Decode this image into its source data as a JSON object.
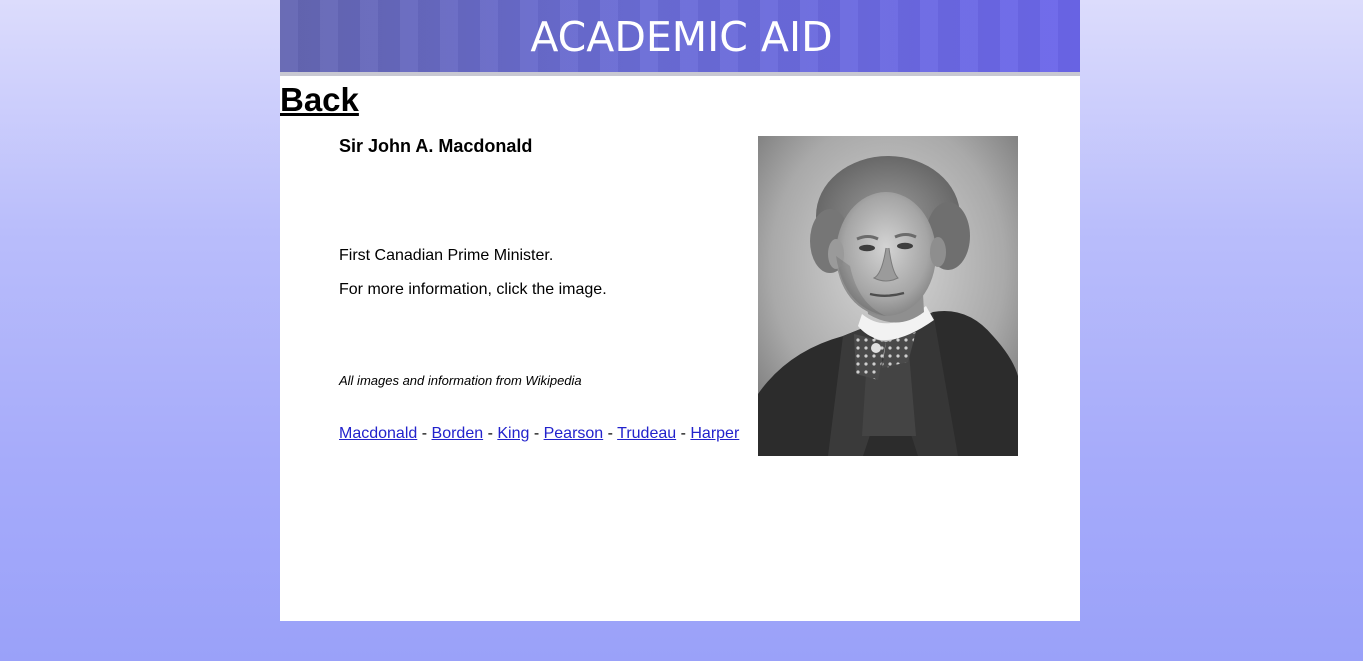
{
  "banner": {
    "title": "ACADEMIC AID"
  },
  "nav": {
    "back_label": "Back"
  },
  "main": {
    "name": "Sir John A. Macdonald",
    "description_line1": "First Canadian Prime Minister.",
    "description_line2": "For more information, click the image.",
    "credit": "All images and information from Wikipedia",
    "separator": "-",
    "pm_links": [
      "Macdonald",
      "Borden",
      "King",
      "Pearson",
      "Trudeau",
      "Harper"
    ]
  },
  "colors": {
    "link": "#2222cc",
    "banner_start": "#6466b2",
    "banner_end": "#6b66ea",
    "background_top": "#dcdcfc",
    "background_bottom": "#9aa1f9"
  },
  "icons": {
    "portrait": "portrait-photo"
  }
}
